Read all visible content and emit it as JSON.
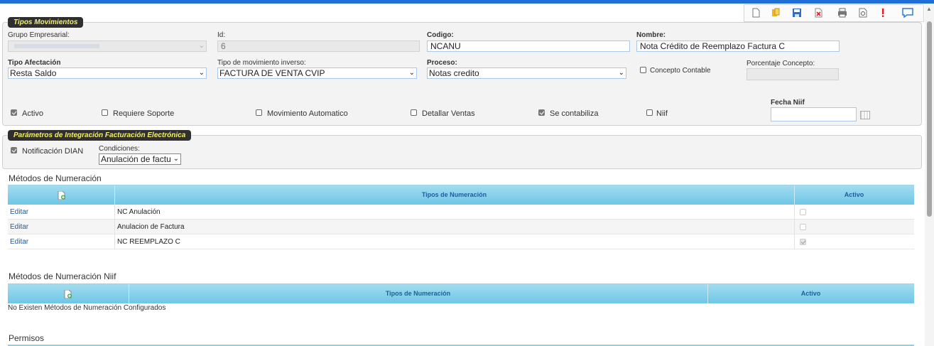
{
  "toolbar": {
    "icons": [
      "new-document-icon",
      "copy-icon",
      "save-icon",
      "delete-icon",
      "print-icon",
      "preview-icon",
      "alert-icon",
      "help-chat-icon"
    ]
  },
  "tipos_movimientos": {
    "legend": "Tipos Movimientos",
    "grupo_empresarial": {
      "label": "Grupo Empresarial:",
      "value": ""
    },
    "id": {
      "label": "Id:",
      "value": "6"
    },
    "codigo": {
      "label": "Codigo:",
      "value": "NCANU"
    },
    "nombre": {
      "label": "Nombre:",
      "value": "Nota Crédito de Reemplazo Factura C"
    },
    "tipo_afectacion": {
      "label": "Tipo Afectación",
      "value": "Resta Saldo"
    },
    "tipo_mov_inverso": {
      "label": "Tipo de movimiento inverso:",
      "value": "FACTURA DE VENTA CVIP"
    },
    "proceso": {
      "label": "Proceso:",
      "value": "Notas credito"
    },
    "concepto_contable": {
      "label": "Concepto Contable",
      "checked": false
    },
    "porcentaje_concepto": {
      "label": "Porcentaje Concepto:",
      "value": ""
    },
    "activo": {
      "label": "Activo",
      "checked": true
    },
    "requiere_soporte": {
      "label": "Requiere Soporte",
      "checked": false
    },
    "movimiento_automatico": {
      "label": "Movimiento Automatico",
      "checked": false
    },
    "detallar_ventas": {
      "label": "Detallar Ventas",
      "checked": false
    },
    "se_contabiliza": {
      "label": "Se contabiliza",
      "checked": true
    },
    "niif": {
      "label": "Niif",
      "checked": false
    },
    "fecha_niif": {
      "label": "Fecha Niif",
      "value": ""
    }
  },
  "integracion": {
    "legend": "Parámetros de Integración Facturación Electrónica",
    "notificacion_dian": {
      "label": "Notificación DIAN",
      "checked": true
    },
    "condiciones": {
      "label": "Condiciones:",
      "value": "Anulación de factu"
    }
  },
  "metodos_numeracion": {
    "title": "Métodos de Numeración",
    "columns": [
      "Tipos de Numeración",
      "Activo"
    ],
    "rows": [
      {
        "action": "Editar",
        "tipo": "NC Anulación",
        "activo": false
      },
      {
        "action": "Editar",
        "tipo": "Anulacion de Factura",
        "activo": false
      },
      {
        "action": "Editar",
        "tipo": "NC REEMPLAZO C",
        "activo": true
      }
    ]
  },
  "metodos_numeracion_niif": {
    "title": "Métodos de Numeración Niif",
    "columns": [
      "Tipos de Numeración",
      "Activo"
    ],
    "empty_message": "No Existen Métodos de Numeración Configurados"
  },
  "permisos": {
    "title": "Permisos"
  },
  "colors": {
    "accent": "#1f6fd6",
    "grid_header": "#6ec6e6",
    "legend_bg": "#2f2f2f",
    "legend_text": "#f4f06a"
  }
}
